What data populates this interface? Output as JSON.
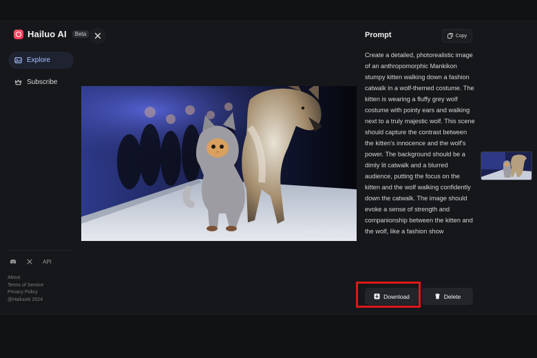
{
  "brand": {
    "name": "Hailuo AI",
    "badge": "Beta"
  },
  "nav": {
    "explore_label": "Explore",
    "subscribe_label": "Subscribe"
  },
  "social": {
    "api_label": "API"
  },
  "footer": {
    "about": "About",
    "terms": "Terms of Service",
    "privacy": "Privacy Policy",
    "copyright": "@HailuoAI 2024"
  },
  "image": {
    "watermark": "MINIMAX | @ hailuo AI"
  },
  "prompt": {
    "title": "Prompt",
    "copy_label": "Copy",
    "text": "Create a detailed, photorealistic image of an anthropomorphic Mankikon stumpy kitten walking down a fashion catwalk in a wolf-themed costume. The kitten is wearing a fluffy grey wolf costume with pointy ears and walking next to a truly majestic wolf. This scene should capture the contrast between the kitten's innocence and the wolf's power. The background should be a dimly lit catwalk and a blurred audience, putting the focus on the kitten and the wolf walking confidently down the catwalk. The image should evoke a sense of strength and companionship between the kitten and the wolf, like a fashion show"
  },
  "actions": {
    "download_label": "Download",
    "delete_label": "Delete"
  },
  "colors": {
    "background": "#16171a",
    "accent_active": "#a9c3ff",
    "highlight_box": "#e0161b"
  }
}
